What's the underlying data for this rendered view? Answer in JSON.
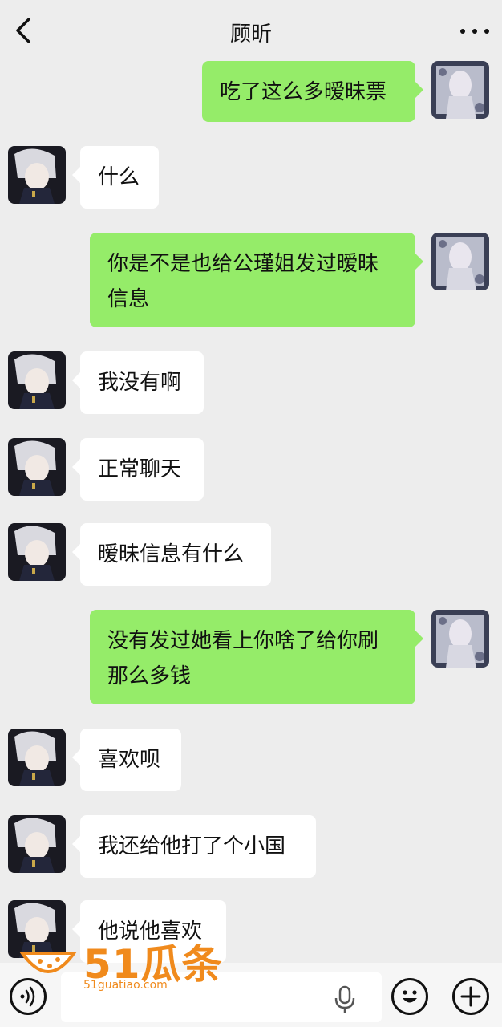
{
  "header": {
    "title": "顾昕"
  },
  "messages": [
    {
      "side": "out",
      "text": "吃了这么多暧昧票"
    },
    {
      "side": "in",
      "text": "什么"
    },
    {
      "side": "out",
      "lines": [
        "你是不是也给公瑾姐发过暧昧",
        "信息"
      ]
    },
    {
      "side": "in",
      "text": "我没有啊"
    },
    {
      "side": "in",
      "text": "正常聊天"
    },
    {
      "side": "in",
      "text": "暧昧信息有什么"
    },
    {
      "side": "out",
      "lines": [
        "没有发过她看上你啥了给你刷",
        "那么多钱"
      ]
    },
    {
      "side": "in",
      "text": "喜欢呗"
    },
    {
      "side": "in",
      "text": "我还给他打了个小国"
    },
    {
      "side": "in",
      "text": "他说他喜欢"
    }
  ],
  "watermark": {
    "text": "51瓜条",
    "sub": "51guatiao.com"
  },
  "icons": {
    "back": "chevron-left-icon",
    "more": "more-dots-icon",
    "voice": "voice-icon",
    "mic": "microphone-icon",
    "emoji": "emoji-icon",
    "plus": "plus-icon"
  },
  "colors": {
    "background": "#ededed",
    "outgoing_bubble": "#95ec69",
    "incoming_bubble": "#ffffff",
    "watermark": "#f08a1c"
  }
}
